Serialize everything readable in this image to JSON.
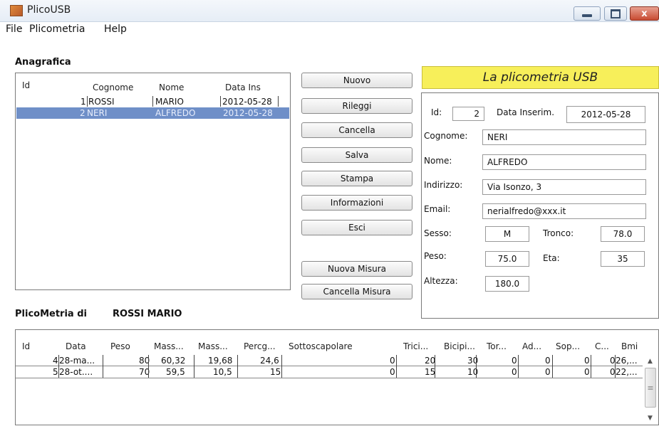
{
  "window": {
    "title": "PlicoUSB",
    "close_label": "x"
  },
  "menu": [
    "File",
    "Plicometria",
    "Help"
  ],
  "anagrafica": {
    "label": "Anagrafica",
    "columns": [
      "Id",
      "Cognome",
      "Nome",
      "Data Ins"
    ],
    "rows": [
      {
        "id": "1",
        "cognome": "ROSSI",
        "nome": "MARIO",
        "data": "2012-05-28",
        "selected": false
      },
      {
        "id": "2",
        "cognome": "NERI",
        "nome": "ALFREDO",
        "data": "2012-05-28",
        "selected": true
      }
    ]
  },
  "buttons": {
    "nuovo": "Nuovo",
    "rileggi": "Rileggi",
    "cancella": "Cancella",
    "salva": "Salva",
    "stampa": "Stampa",
    "informazioni": "Informazioni",
    "esci": "Esci",
    "nuova_misura": "Nuova Misura",
    "cancella_misura": "Cancella Misura"
  },
  "banner": "La plicometria USB",
  "form": {
    "id": {
      "label": "Id:",
      "value": "2"
    },
    "data_inserim": {
      "label": "Data Inserim.",
      "value": "2012-05-28"
    },
    "cognome": {
      "label": "Cognome:",
      "value": "NERI"
    },
    "nome": {
      "label": "Nome:",
      "value": "ALFREDO"
    },
    "indirizzo": {
      "label": "Indirizzo:",
      "value": "Via Isonzo, 3"
    },
    "email": {
      "label": "Email:",
      "value": "nerialfredo@xxx.it"
    },
    "sesso": {
      "label": "Sesso:",
      "value": "M"
    },
    "tronco": {
      "label": "Tronco:",
      "value": "78.0"
    },
    "peso": {
      "label": "Peso:",
      "value": "75.0"
    },
    "eta": {
      "label": "Eta:",
      "value": "35"
    },
    "altezza": {
      "label": "Altezza:",
      "value": "180.0"
    }
  },
  "plicometria": {
    "label": "PlicoMetria di",
    "person": "ROSSI MARIO",
    "columns": [
      "Id",
      "Data",
      "Peso",
      "Mass...",
      "Mass...",
      "Percg...",
      "Sottoscapolare",
      "Trici...",
      "Bicipi...",
      "Tor...",
      "Ad...",
      "Sop...",
      "C...",
      "Bmi"
    ],
    "rows": [
      [
        "4",
        "28-ma...",
        "80",
        "60,32",
        "19,68",
        "24,6",
        "0",
        "20",
        "30",
        "0",
        "0",
        "0",
        "0",
        "26,..."
      ],
      [
        "5",
        "28-ot....",
        "70",
        "59,5",
        "10,5",
        "15",
        "0",
        "15",
        "10",
        "0",
        "0",
        "0",
        "0",
        "22,..."
      ]
    ]
  },
  "icons": {
    "min": "minimize-icon",
    "max": "maximize-icon",
    "close": "close-icon",
    "app": "app-icon"
  }
}
